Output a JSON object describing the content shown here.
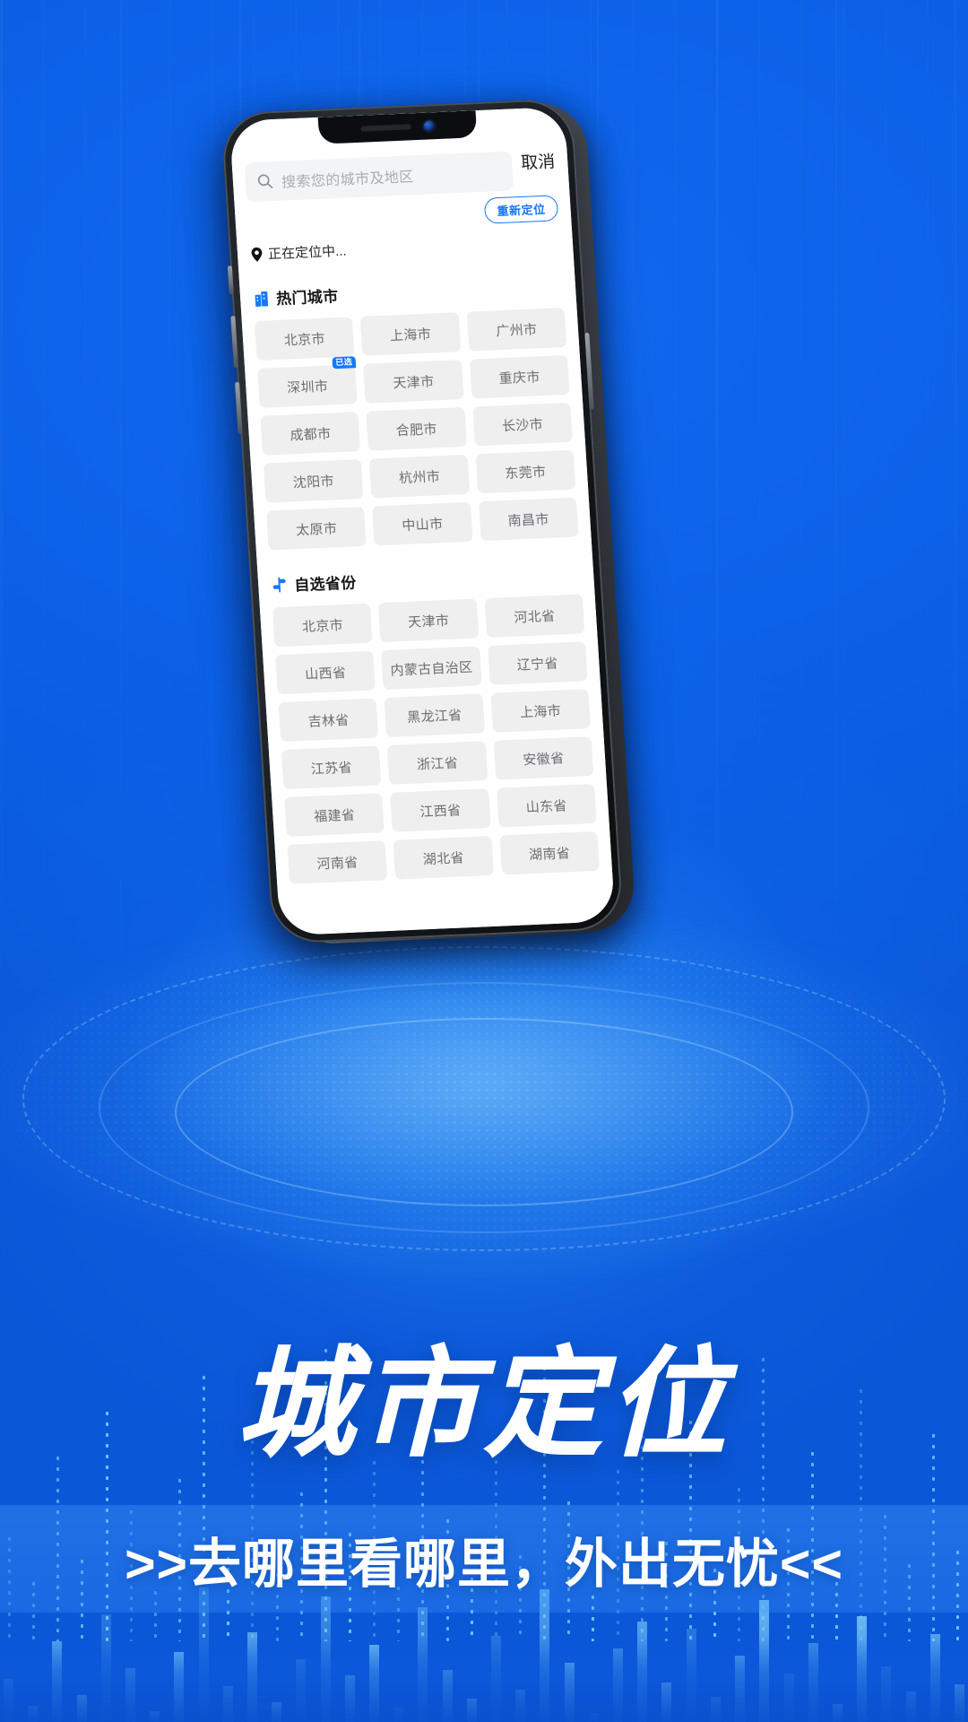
{
  "background": {
    "brand_blue": "#0a62e8",
    "accent_blue": "#1677ff",
    "glow_cyan": "#82e1ff"
  },
  "phone": {
    "notch": {
      "speaker": "earpiece-speaker",
      "camera": "front-camera"
    }
  },
  "app": {
    "search": {
      "icon": "search-icon",
      "placeholder": "搜索您的城市及地区",
      "value": ""
    },
    "cancel_label": "取消",
    "relocate_label": "重新定位",
    "location_status": {
      "icon": "location-pin-icon",
      "text": "正在定位中..."
    },
    "hot_cities": {
      "icon": "building-icon",
      "title": "热门城市",
      "selected_badge": "已选",
      "selected_item": "深圳市",
      "items": [
        "北京市",
        "上海市",
        "广州市",
        "深圳市",
        "天津市",
        "重庆市",
        "成都市",
        "合肥市",
        "长沙市",
        "沈阳市",
        "杭州市",
        "东莞市",
        "太原市",
        "中山市",
        "南昌市"
      ]
    },
    "provinces": {
      "icon": "signpost-icon",
      "title": "自选省份",
      "items": [
        "北京市",
        "天津市",
        "河北省",
        "山西省",
        "内蒙古自治区",
        "辽宁省",
        "吉林省",
        "黑龙江省",
        "上海市",
        "江苏省",
        "浙江省",
        "安徽省",
        "福建省",
        "江西省",
        "山东省",
        "河南省",
        "湖北省",
        "湖南省"
      ]
    }
  },
  "promo": {
    "headline": "城市定位",
    "subtitle": ">>去哪里看哪里，外出无忧<<"
  }
}
